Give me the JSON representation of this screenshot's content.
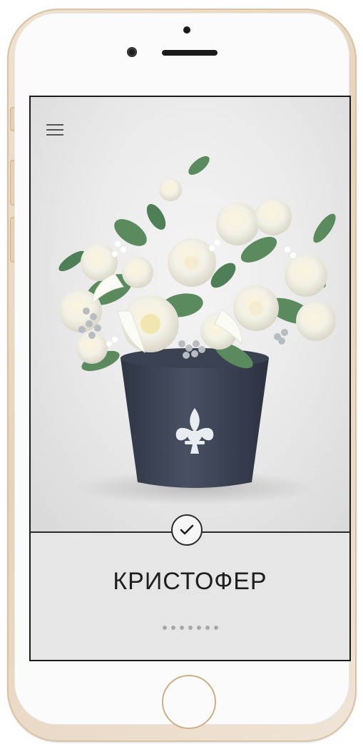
{
  "product": {
    "title": "КРИСТОФЕР",
    "pager_count": 7
  },
  "icons": {
    "menu": "hamburger-icon",
    "select": "check-icon",
    "vase_emblem": "fleur-de-lis-icon"
  },
  "colors": {
    "screen_border": "#1b1b1b",
    "phone_frame": "#e6d3bc",
    "vase": "#3f4656",
    "emblem": "#e9edf2",
    "foliage": "#5b8a5e",
    "bloom": "#f4f1e4",
    "bloom_center": "#f2e6b0"
  }
}
